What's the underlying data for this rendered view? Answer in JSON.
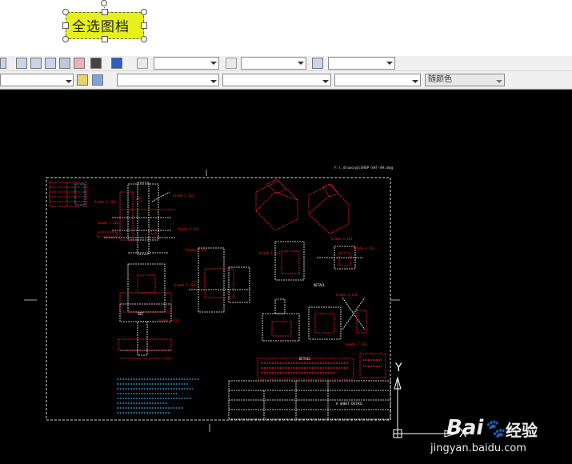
{
  "annotation": {
    "label": "全选图档"
  },
  "toolbar": {
    "layer_combo_value": "",
    "linetype_combo_value": "",
    "lineweight_combo_value": "",
    "plotstyle_combo_value": "",
    "color_combo_value": "随颜色",
    "help_icon": "help-icon",
    "calculator_icon": "calculator-icon"
  },
  "drawing": {
    "ucs_y_label": "Y",
    "ucs_x_label": "X",
    "title_text": "A SHEET DETAIL",
    "text_color": "#ff2020",
    "note_color": "#3fb6ff",
    "line_color": "#ffffff"
  },
  "watermark": {
    "logo": "Bai",
    "logo_suffix": "经验",
    "url": "jingyan.baidu.com"
  }
}
